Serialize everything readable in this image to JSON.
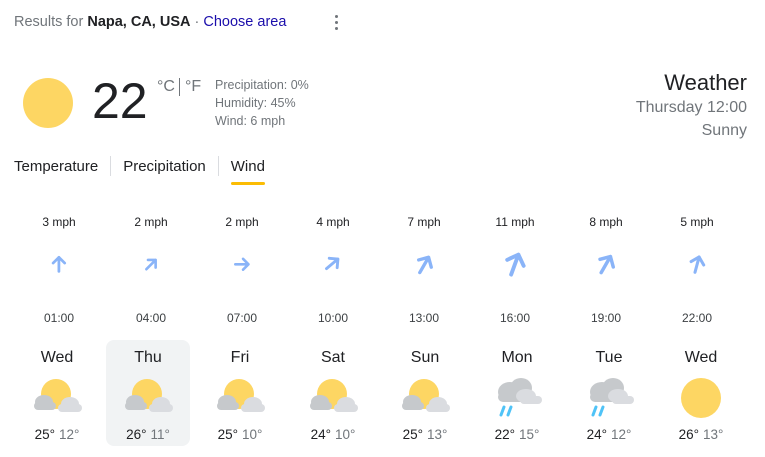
{
  "header": {
    "results_prefix": "Results for",
    "location": "Napa, CA, USA",
    "dot": " · ",
    "choose_area": "Choose area"
  },
  "current": {
    "temperature": "22",
    "unit_c": "°C",
    "unit_f": "°F",
    "precipitation": "Precipitation: 0%",
    "humidity": "Humidity: 45%",
    "wind": "Wind: 6 mph",
    "icon": "sun-icon"
  },
  "side": {
    "title": "Weather",
    "datetime": "Thursday 12:00",
    "condition": "Sunny"
  },
  "tabs": [
    {
      "label": "Temperature",
      "active": false
    },
    {
      "label": "Precipitation",
      "active": false
    },
    {
      "label": "Wind",
      "active": true
    }
  ],
  "wind_hours": [
    {
      "speed": "3 mph",
      "time": "01:00",
      "dir_deg": 0
    },
    {
      "speed": "2 mph",
      "time": "04:00",
      "dir_deg": 45
    },
    {
      "speed": "2 mph",
      "time": "07:00",
      "dir_deg": 90
    },
    {
      "speed": "4 mph",
      "time": "10:00",
      "dir_deg": 50
    },
    {
      "speed": "7 mph",
      "time": "13:00",
      "dir_deg": 30
    },
    {
      "speed": "11 mph",
      "time": "16:00",
      "dir_deg": 20
    },
    {
      "speed": "8 mph",
      "time": "19:00",
      "dir_deg": 30
    },
    {
      "speed": "5 mph",
      "time": "22:00",
      "dir_deg": 15
    }
  ],
  "forecast": [
    {
      "day": "Wed",
      "high": "25°",
      "low": "12°",
      "icon": "partly-cloudy",
      "selected": false
    },
    {
      "day": "Thu",
      "high": "26°",
      "low": "11°",
      "icon": "partly-cloudy",
      "selected": true
    },
    {
      "day": "Fri",
      "high": "25°",
      "low": "10°",
      "icon": "partly-cloudy",
      "selected": false
    },
    {
      "day": "Sat",
      "high": "24°",
      "low": "10°",
      "icon": "partly-cloudy",
      "selected": false
    },
    {
      "day": "Sun",
      "high": "25°",
      "low": "13°",
      "icon": "partly-cloudy",
      "selected": false
    },
    {
      "day": "Mon",
      "high": "22°",
      "low": "15°",
      "icon": "rain",
      "selected": false
    },
    {
      "day": "Tue",
      "high": "24°",
      "low": "12°",
      "icon": "rain",
      "selected": false
    },
    {
      "day": "Wed",
      "high": "26°",
      "low": "13°",
      "icon": "sunny",
      "selected": false
    }
  ],
  "colors": {
    "sun": "#fdd663",
    "cloud": "#dadce0",
    "arrow": "#8ab4f8",
    "rain": "#4fc3f7",
    "tab_underline": "#fbbc04",
    "link": "#1a0dab"
  }
}
